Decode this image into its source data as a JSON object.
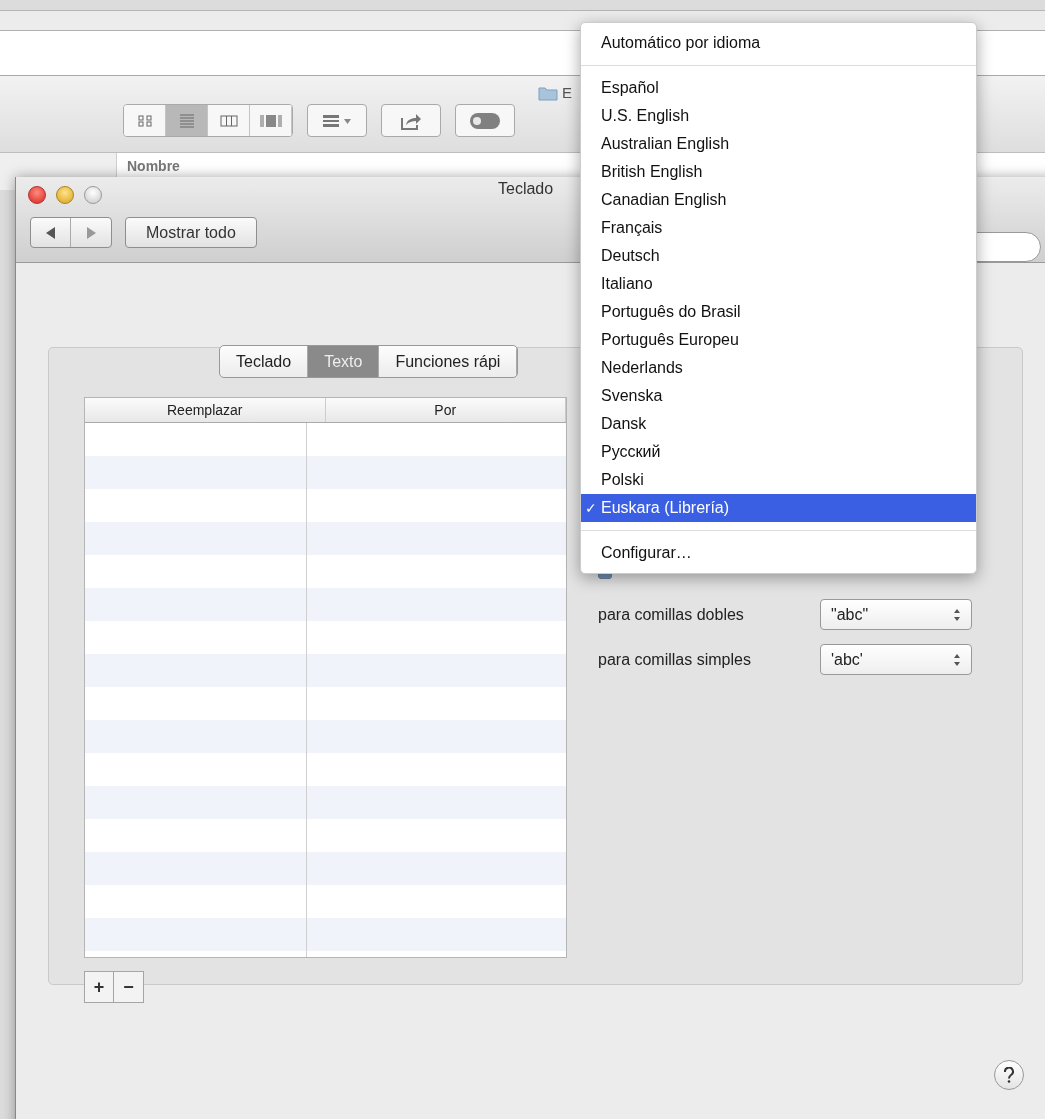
{
  "finder": {
    "title": "E",
    "view_modes": [
      {
        "kind": "icons",
        "selected": false
      },
      {
        "kind": "list",
        "selected": true
      },
      {
        "kind": "columns",
        "selected": false
      },
      {
        "kind": "coverflow",
        "selected": false
      }
    ],
    "column": "Nombre"
  },
  "prefs": {
    "title": "Teclado",
    "show_all": "Mostrar todo",
    "tabs": [
      {
        "label": "Teclado",
        "selected": false
      },
      {
        "label": "Texto",
        "selected": true
      },
      {
        "label": "Funciones rápi",
        "selected": false
      }
    ],
    "table": {
      "columns": [
        "Reemplazar",
        "Por"
      ]
    },
    "add": "+",
    "remove": "−",
    "smart_quotes": {
      "checked": true
    },
    "quote_options": [
      {
        "label": "para comillas dobles",
        "value": "\"abc\""
      },
      {
        "label": "para comillas simples",
        "value": "'abc'"
      }
    ]
  },
  "menu": [
    {
      "kind": "item",
      "label": "Automático por idioma",
      "selected": false
    },
    {
      "kind": "separator"
    },
    {
      "kind": "item",
      "label": "Español",
      "selected": false
    },
    {
      "kind": "item",
      "label": "U.S. English",
      "selected": false
    },
    {
      "kind": "item",
      "label": "Australian English",
      "selected": false
    },
    {
      "kind": "item",
      "label": "British English",
      "selected": false
    },
    {
      "kind": "item",
      "label": "Canadian English",
      "selected": false
    },
    {
      "kind": "item",
      "label": "Français",
      "selected": false
    },
    {
      "kind": "item",
      "label": "Deutsch",
      "selected": false
    },
    {
      "kind": "item",
      "label": "Italiano",
      "selected": false
    },
    {
      "kind": "item",
      "label": "Português do Brasil",
      "selected": false
    },
    {
      "kind": "item",
      "label": "Português Europeu",
      "selected": false
    },
    {
      "kind": "item",
      "label": "Nederlands",
      "selected": false
    },
    {
      "kind": "item",
      "label": "Svenska",
      "selected": false
    },
    {
      "kind": "item",
      "label": "Dansk",
      "selected": false
    },
    {
      "kind": "item",
      "label": "Русский",
      "selected": false
    },
    {
      "kind": "item",
      "label": "Polski",
      "selected": false
    },
    {
      "kind": "item",
      "label": "Euskara (Librería)",
      "selected": true,
      "mark": "✓"
    },
    {
      "kind": "separator"
    },
    {
      "kind": "item",
      "label": "Configurar…",
      "selected": false
    }
  ]
}
